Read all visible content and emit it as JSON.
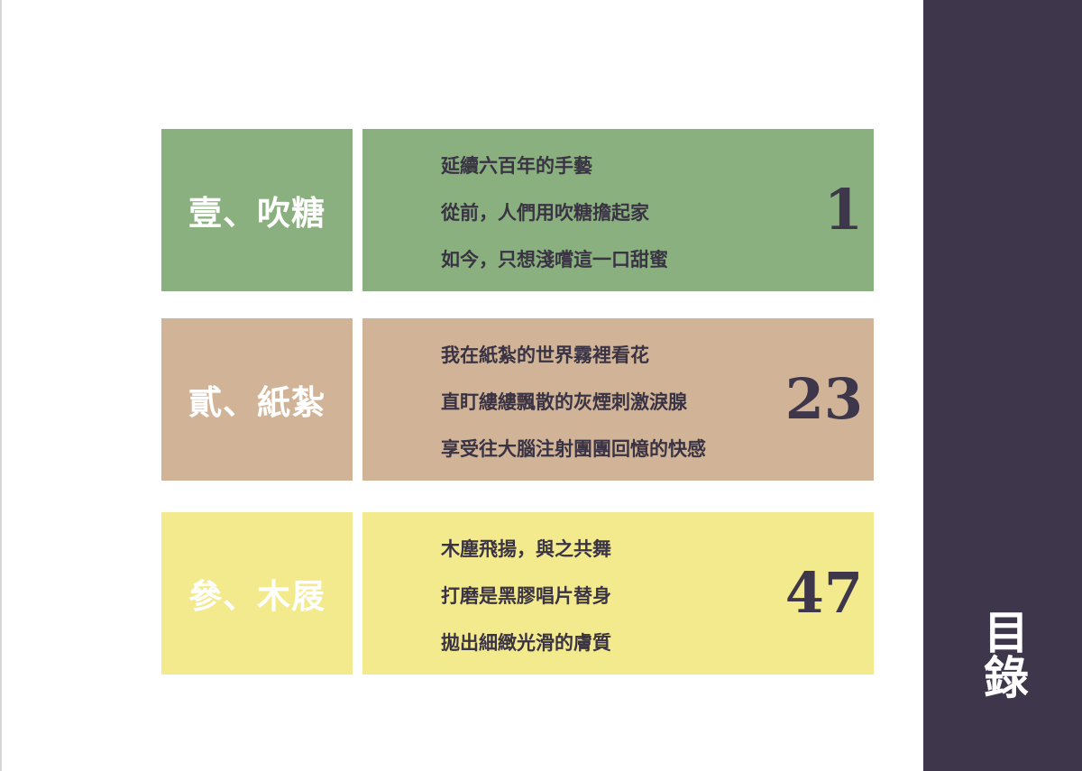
{
  "sidebar": {
    "title": "目錄"
  },
  "chapters": [
    {
      "label": "壹、吹糖",
      "lines": [
        "延續六百年的手藝",
        "從前，人們用吹糖擔起家",
        "如今，只想淺嚐這一口甜蜜"
      ],
      "page": "1",
      "color": "#89b07e"
    },
    {
      "label": "貳、紙紮",
      "lines": [
        "我在紙紮的世界霧裡看花",
        "直盯縷縷飄散的灰煙刺激淚腺",
        "享受往大腦注射團團回憶的快感"
      ],
      "page": "23",
      "color": "#d1b497"
    },
    {
      "label": "參、木屐",
      "lines": [
        "木塵飛揚，與之共舞",
        "打磨是黑膠唱片替身",
        "拋出細緻光滑的膚質"
      ],
      "page": "47",
      "color": "#f3e98d"
    }
  ]
}
